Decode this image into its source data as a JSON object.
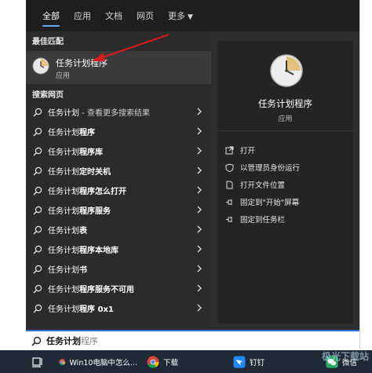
{
  "tabs": [
    {
      "label": "全部",
      "active": true
    },
    {
      "label": "应用"
    },
    {
      "label": "文档"
    },
    {
      "label": "网页"
    },
    {
      "label": "更多",
      "caret": "▼"
    }
  ],
  "left": {
    "best_match_heading": "最佳匹配",
    "best_match": {
      "title": "任务计划程序",
      "subtitle": "应用",
      "icon": "clock-icon"
    },
    "web_heading": "搜索网页",
    "results": [
      {
        "prefix": "任务计划",
        "suffix": " - 查看更多搜索结果"
      },
      {
        "prefix": "任务计划",
        "bold": "程序"
      },
      {
        "prefix": "任务计划",
        "bold": "程序库"
      },
      {
        "prefix": "任务计划",
        "bold": "定时关机"
      },
      {
        "prefix": "任务计划",
        "bold": "程序怎么打开"
      },
      {
        "prefix": "任务计划",
        "bold": "程序服务"
      },
      {
        "prefix": "任务计划",
        "bold": "表"
      },
      {
        "prefix": "任务计划",
        "bold": "程序本地库"
      },
      {
        "prefix": "任务计划",
        "bold": "书"
      },
      {
        "prefix": "任务计划",
        "bold": "程序服务不可用"
      },
      {
        "prefix": "任务计划",
        "bold": "程序 0x1"
      }
    ]
  },
  "right": {
    "app_title": "任务计划程序",
    "app_type": "应用",
    "actions": [
      {
        "label": "打开",
        "icon": "open-icon"
      },
      {
        "label": "以管理员身份运行",
        "icon": "shield-icon"
      },
      {
        "label": "打开文件位置",
        "icon": "file-location-icon"
      },
      {
        "label": "固定到\"开始\"屏幕",
        "icon": "pin-icon"
      },
      {
        "label": "固定到任务栏",
        "icon": "pin-icon"
      }
    ]
  },
  "search": {
    "typed": "任务计划",
    "suggestion": "程序"
  },
  "taskbar": {
    "items": [
      {
        "label": "",
        "icon": "task-view-icon"
      },
      {
        "label": "Win10电脑中怎么...",
        "icon": "chrome-icon"
      },
      {
        "label": "下载",
        "icon": "chrome-icon"
      },
      {
        "label": "钉钉",
        "icon": "dingtalk-icon"
      },
      {
        "label": "微信",
        "icon": "wechat-icon"
      }
    ]
  },
  "watermark": "极光下载站",
  "colors": {
    "accent": "#2f6fd6",
    "arrow": "#d61b1b",
    "panel": "#272727",
    "taskbar": "#1f2a36"
  }
}
